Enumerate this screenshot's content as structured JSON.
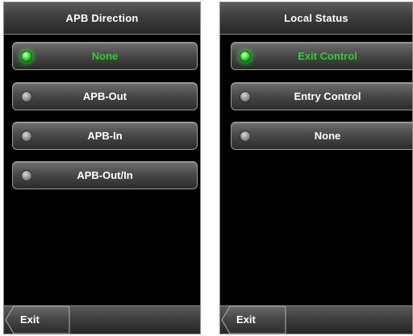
{
  "screens": [
    {
      "title": "APB Direction",
      "options": [
        {
          "label": "None",
          "selected": true
        },
        {
          "label": "APB-Out",
          "selected": false
        },
        {
          "label": "APB-In",
          "selected": false
        },
        {
          "label": "APB-Out/In",
          "selected": false
        }
      ],
      "exit_label": "Exit"
    },
    {
      "title": "Local Status",
      "options": [
        {
          "label": "Exit Control",
          "selected": true
        },
        {
          "label": "Entry Control",
          "selected": false
        },
        {
          "label": "None",
          "selected": false
        }
      ],
      "exit_label": "Exit"
    }
  ],
  "colors": {
    "selected_text": "#2bd12b",
    "selected_indicator": "#4cf24c",
    "unselected_indicator": "#9a9a9a",
    "background": "#000000"
  },
  "icons": {
    "selected_radio": "green-radio-on-icon",
    "unselected_radio": "gray-radio-off-icon"
  }
}
